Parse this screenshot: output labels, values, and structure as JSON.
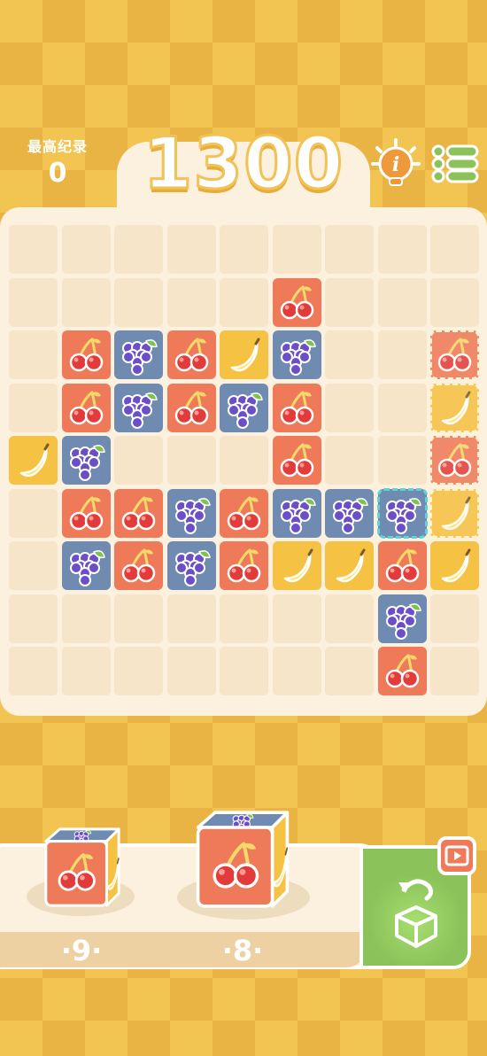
{
  "header": {
    "best_label": "最高纪录",
    "best_value": "0",
    "score": "1300"
  },
  "icons": {
    "info": "info-bulb-icon",
    "menu": "menu-list-icon",
    "undo": "undo-icon",
    "cube": "cube-icon",
    "video": "video-play-icon"
  },
  "colors": {
    "background": "#f2c451",
    "board": "#fbf1de",
    "cell": "#f6e5c9",
    "cherry": "#ef7a5a",
    "grape": "#6f8bb1",
    "banana": "#f6c243",
    "undo_panel": "#8bc25a"
  },
  "board": {
    "rows": 9,
    "cols": 9,
    "tiles": [
      {
        "row": 1,
        "col": 5,
        "fruit": "cherry"
      },
      {
        "row": 2,
        "col": 1,
        "fruit": "cherry"
      },
      {
        "row": 2,
        "col": 2,
        "fruit": "grape"
      },
      {
        "row": 2,
        "col": 3,
        "fruit": "cherry"
      },
      {
        "row": 2,
        "col": 4,
        "fruit": "banana"
      },
      {
        "row": 2,
        "col": 5,
        "fruit": "grape"
      },
      {
        "row": 3,
        "col": 1,
        "fruit": "cherry"
      },
      {
        "row": 3,
        "col": 2,
        "fruit": "grape"
      },
      {
        "row": 3,
        "col": 3,
        "fruit": "cherry"
      },
      {
        "row": 3,
        "col": 4,
        "fruit": "grape"
      },
      {
        "row": 3,
        "col": 5,
        "fruit": "cherry"
      },
      {
        "row": 4,
        "col": 0,
        "fruit": "banana"
      },
      {
        "row": 4,
        "col": 1,
        "fruit": "grape"
      },
      {
        "row": 4,
        "col": 5,
        "fruit": "cherry"
      },
      {
        "row": 5,
        "col": 1,
        "fruit": "cherry"
      },
      {
        "row": 5,
        "col": 2,
        "fruit": "cherry"
      },
      {
        "row": 5,
        "col": 3,
        "fruit": "grape"
      },
      {
        "row": 5,
        "col": 4,
        "fruit": "cherry"
      },
      {
        "row": 5,
        "col": 5,
        "fruit": "grape"
      },
      {
        "row": 5,
        "col": 6,
        "fruit": "grape"
      },
      {
        "row": 5,
        "col": 7,
        "fruit": "grape",
        "highlight": "teal"
      },
      {
        "row": 6,
        "col": 1,
        "fruit": "grape"
      },
      {
        "row": 6,
        "col": 2,
        "fruit": "cherry"
      },
      {
        "row": 6,
        "col": 3,
        "fruit": "grape"
      },
      {
        "row": 6,
        "col": 4,
        "fruit": "cherry"
      },
      {
        "row": 6,
        "col": 5,
        "fruit": "banana"
      },
      {
        "row": 6,
        "col": 6,
        "fruit": "banana"
      },
      {
        "row": 6,
        "col": 7,
        "fruit": "cherry"
      },
      {
        "row": 6,
        "col": 8,
        "fruit": "banana"
      },
      {
        "row": 7,
        "col": 7,
        "fruit": "grape"
      },
      {
        "row": 8,
        "col": 7,
        "fruit": "cherry"
      },
      {
        "row": 2,
        "col": 8,
        "fruit": "cherry",
        "ghost": true
      },
      {
        "row": 3,
        "col": 8,
        "fruit": "banana",
        "ghost": true
      },
      {
        "row": 4,
        "col": 8,
        "fruit": "cherry",
        "ghost": true
      },
      {
        "row": 5,
        "col": 8,
        "fruit": "banana",
        "ghost": true
      }
    ]
  },
  "tray": {
    "pieces": [
      {
        "count": "·9·",
        "front": "cherry",
        "side": "banana",
        "top": "grape"
      },
      {
        "count": "·8·",
        "front": "cherry",
        "side": "banana",
        "top": "grape"
      }
    ]
  }
}
